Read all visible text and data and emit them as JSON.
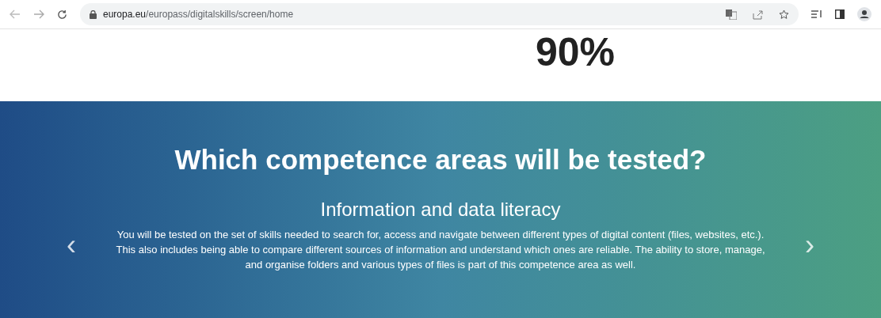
{
  "browser": {
    "url_host": "europa.eu",
    "url_path": "/europass/digitalskills/screen/home"
  },
  "stat": {
    "value": "90%"
  },
  "competence_section": {
    "title": "Which competence areas will be tested?",
    "slide": {
      "heading": "Information and data literacy",
      "description": "You will be tested on the set of skills needed to search for, access and navigate between different types of digital content (files, websites, etc.). This also includes being able to compare different sources of information and understand which ones are reliable. The ability to store, manage, and organise folders and various types of files is part of this competence area as well."
    },
    "previous": "‹",
    "next": "›"
  }
}
